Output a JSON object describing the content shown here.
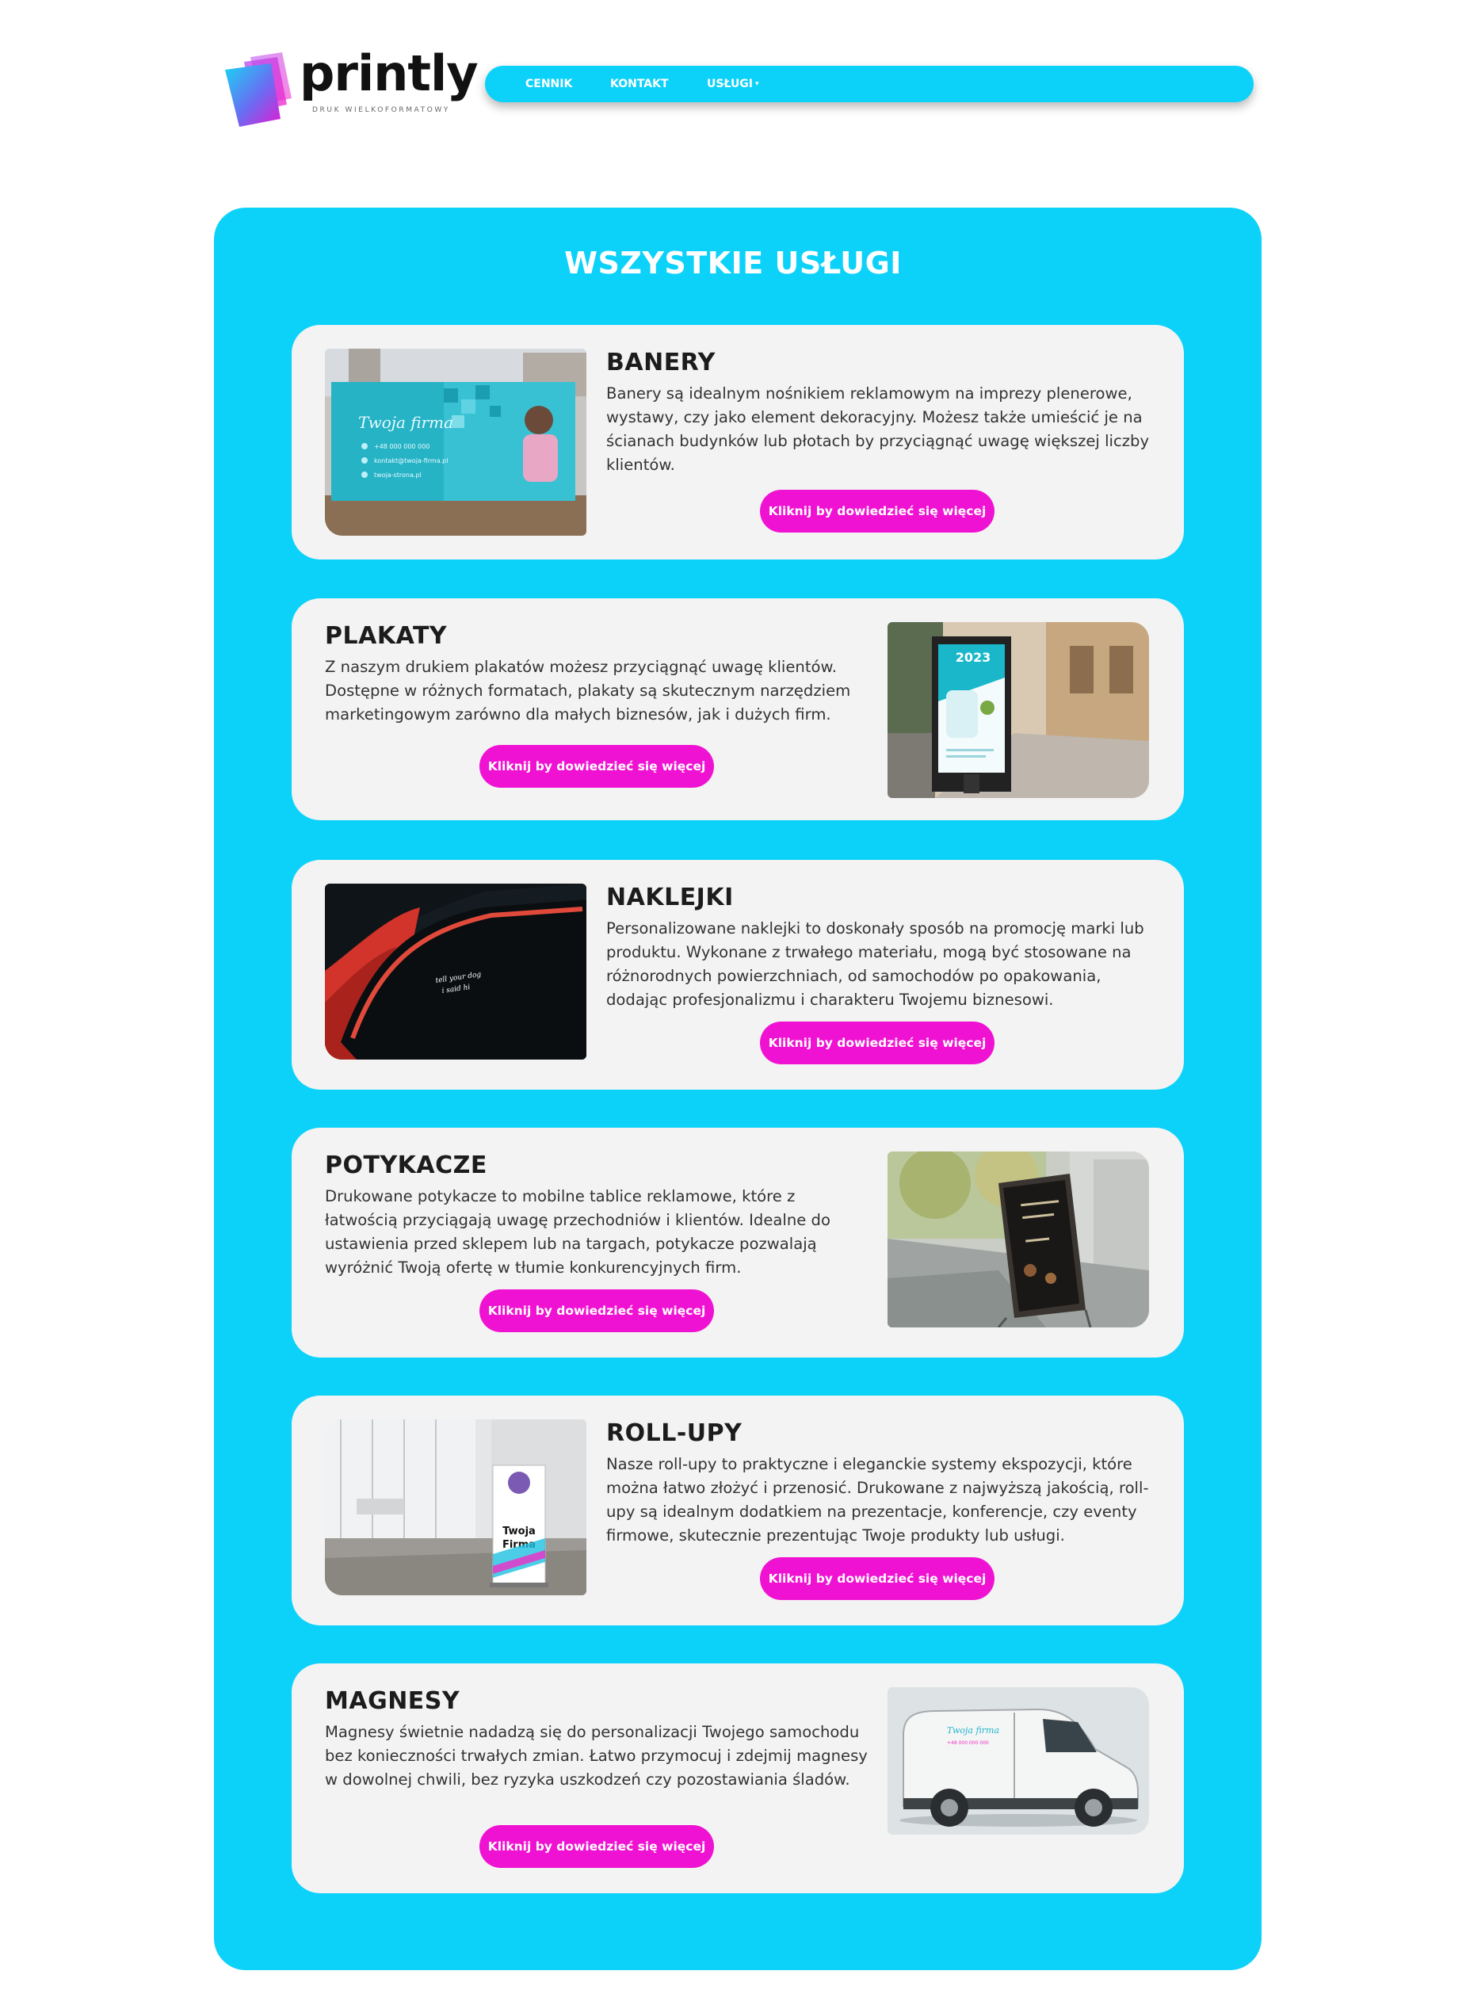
{
  "brand": {
    "name": "printly",
    "tagline": "DRUK WIELKOFORMATOWY"
  },
  "nav": {
    "items": [
      {
        "label": "CENNIK"
      },
      {
        "label": "KONTAKT"
      },
      {
        "label": "USŁUGI"
      }
    ]
  },
  "colors": {
    "accent": "#0cd2fa",
    "button": "#f012d2",
    "card": "#f3f3f3"
  },
  "section": {
    "title": "WSZYSTKIE USŁUGI"
  },
  "services": [
    {
      "title": "BANERY",
      "description": "Banery są idealnym nośnikiem reklamowym na imprezy plenerowe, wystawy, czy jako element dekoracyjny. Możesz także umieścić je na ścianach budynków lub płotach by przyciągnąć uwagę większej liczby klientów.",
      "button": "Kliknij by dowiedzieć się więcej",
      "image_text": {
        "brand": "Twoja firma",
        "phone": "+48 000 000 000",
        "email": "kontakt@twoja-firma.pl",
        "web": "twoja-strona.pl"
      }
    },
    {
      "title": "PLAKATY",
      "description": "Z naszym drukiem plakatów możesz przyciągnąć uwagę klientów. Dostępne w różnych formatach, plakaty są skutecznym narzędziem marketingowym zarówno dla małych biznesów, jak i dużych firm.",
      "button": "Kliknij by dowiedzieć się więcej",
      "image_text": {
        "year": "2023"
      }
    },
    {
      "title": "NAKLEJKI",
      "description": "Personalizowane naklejki to doskonały sposób na promocję marki lub produktu. Wykonane z trwałego materiału, mogą być stosowane na różnorodnych powierzchniach, od samochodów po opakowania, dodając profesjonalizmu i charakteru Twojemu biznesowi.",
      "button": "Kliknij by dowiedzieć się więcej",
      "image_text": {
        "sticker_line1": "tell your dog",
        "sticker_line2": "i said hi"
      }
    },
    {
      "title": "POTYKACZE",
      "description": "Drukowane potykacze to mobilne tablice reklamowe, które z łatwością przyciągają uwagę przechodniów i klientów. Idealne do ustawienia przed sklepem lub na targach, potykacze pozwalają wyróżnić Twoją ofertę w tłumie konkurencyjnych firm.",
      "button": "Kliknij by dowiedzieć się więcej"
    },
    {
      "title": "ROLL-UPY",
      "description": "Nasze roll-upy to praktyczne i eleganckie systemy ekspozycji, które można łatwo złożyć i przenosić. Drukowane z najwyższą jakością, roll-upy są idealnym dodatkiem na prezentacje, konferencje, czy eventy firmowe, skutecznie prezentując Twoje produkty lub usługi.",
      "button": "Kliknij by dowiedzieć się więcej",
      "image_text": {
        "line1": "Twoja",
        "line2": "Firma"
      }
    },
    {
      "title": "MAGNESY",
      "description": "Magnesy świetnie nadadzą się do personalizacji Twojego samochodu bez konieczności trwałych zmian. Łatwo przymocuj i zdejmij magnesy w dowolnej chwili, bez ryzyka uszkodzeń czy pozostawiania śladów.",
      "button": "Kliknij by dowiedzieć się więcej",
      "image_text": {
        "brand": "Twoja firma",
        "phone": "+48 000 000 000"
      }
    }
  ]
}
